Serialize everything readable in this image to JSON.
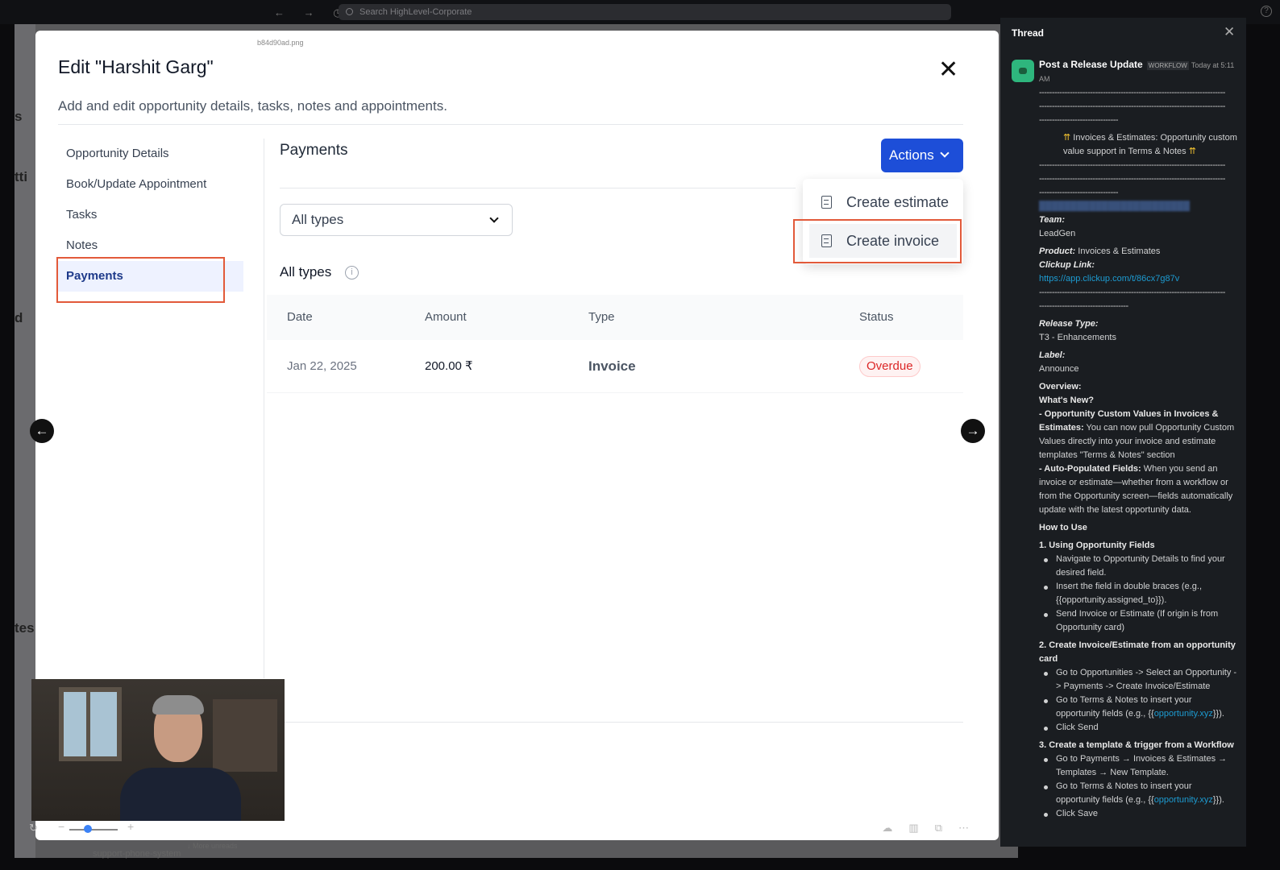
{
  "browser": {
    "search_placeholder": "Search HighLevel-Corporate",
    "help_glyph": "?"
  },
  "modal": {
    "file_label": "b84d90ad.png",
    "title": "Edit \"Harshit Garg\"",
    "subtitle": "Add and edit opportunity details, tasks, notes and appointments.",
    "close_glyph": "✕",
    "nav": [
      {
        "label": "Opportunity Details"
      },
      {
        "label": "Book/Update Appointment"
      },
      {
        "label": "Tasks"
      },
      {
        "label": "Notes"
      },
      {
        "label": "Payments",
        "active": true
      }
    ]
  },
  "payments": {
    "title": "Payments",
    "actions_label": "Actions",
    "filter_value": "All types",
    "section_title": "All types",
    "info_glyph": "i",
    "columns": {
      "date": "Date",
      "amount": "Amount",
      "type": "Type",
      "status": "Status"
    },
    "rows": [
      {
        "date": "Jan 22, 2025",
        "amount": "200.00 ₹",
        "type": "Invoice",
        "status": "Overdue"
      }
    ],
    "menu": {
      "estimate": "Create estimate",
      "invoice": "Create invoice"
    }
  },
  "colors": {
    "accent": "#1d4ed8",
    "highlight": "#e25a3a",
    "overdue": "#dc2626"
  },
  "icons": {
    "prev": "←",
    "next": "→"
  },
  "footer": {
    "more_unreads": "↓ More unreads",
    "channel": "support-phone-system"
  },
  "thread": {
    "title": "Thread",
    "close_glyph": "✕",
    "sender": "Post a Release Update",
    "badge": "WORKFLOW",
    "time": "Today at 5:11 AM",
    "heading": "Invoices & Estimates: Opportunity custom value support in Terms & Notes",
    "team_label": "Team:",
    "team_value": "LeadGen",
    "product_label": "Product:",
    "product_value": "Invoices & Estimates",
    "clickup_label": "Clickup Link:",
    "clickup_url": "https://app.clickup.com/t/86cx7g87v",
    "release_type_label": "Release Type:",
    "release_type_value": "T3 - Enhancements",
    "label_label": "Label:",
    "label_value": "Announce",
    "overview": "Overview:",
    "whats_new": "What's New?",
    "p1_bold": "- Opportunity Custom Values in Invoices & Estimates:",
    "p1_text": "You can now pull Opportunity Custom Values directly into your invoice and estimate templates \"Terms & Notes\" section",
    "p2_bold": "- Auto-Populated Fields:",
    "p2_text": "When you send an invoice or estimate—whether from a workflow or from the Opportunity screen—fields automatically update with the latest opportunity data.",
    "how_to": "How to Use",
    "s1_title": "1. Using Opportunity Fields",
    "s1_items": [
      "Navigate to Opportunity Details to find your desired field.",
      "Insert the field in double braces (e.g., {{opportunity.assigned_to}}).",
      "Send Invoice or Estimate (If origin is from Opportunity card)"
    ],
    "s2_title": "2. Create Invoice/Estimate from an opportunity card",
    "s2_items": [
      "Go to Opportunities -> Select an Opportunity -> Payments -> Create Invoice/Estimate"
    ],
    "s2_item2_pre": "Go to Terms & Notes to insert your opportunity fields (e.g., {{",
    "s2_item2_link": "opportunity.xyz",
    "s2_item2_post": "}}).",
    "s2_item3": "Click Send",
    "s3_title": "3. Create a template & trigger from a Workflow",
    "s3_items": [
      "Go to Payments → Invoices & Estimates → Templates → New Template."
    ],
    "s3_item2_pre": "Go to Terms & Notes to insert your opportunity fields (e.g., {{",
    "s3_item2_link": "opportunity.xyz",
    "s3_item2_post": "}}).",
    "s3_item3": "Click Save"
  }
}
